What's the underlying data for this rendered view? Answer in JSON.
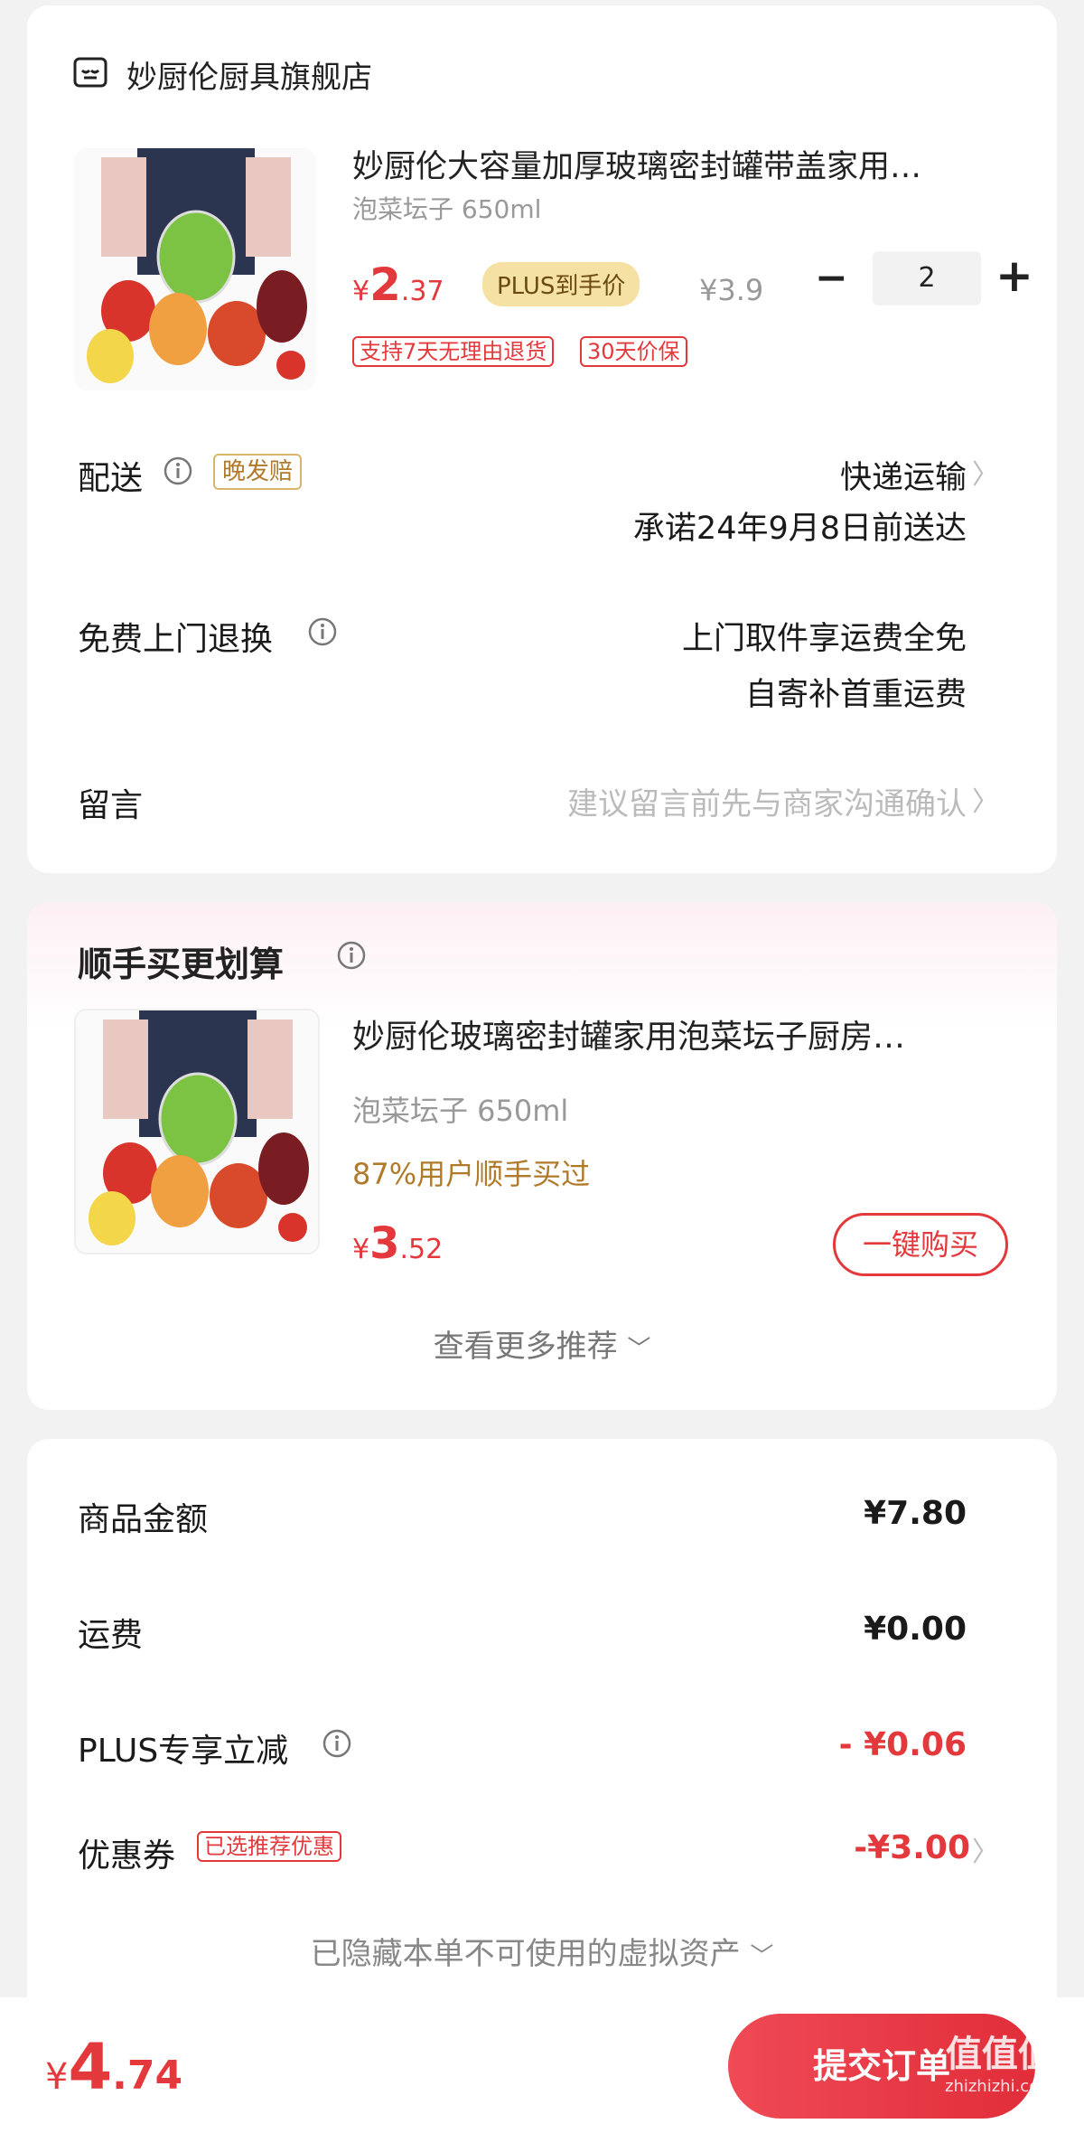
{
  "store": {
    "name": "妙厨伦厨具旗舰店",
    "icon": "store-icon"
  },
  "product": {
    "title": "妙厨伦大容量加厚玻璃密封罐带盖家用…",
    "spec": "泡菜坛子 650ml",
    "price_symbol": "¥",
    "price_int": "2",
    "price_dec": ".37",
    "plus_badge": "PLUS到手价",
    "original_price": "¥3.9",
    "quantity": "2",
    "minus_label": "−",
    "plus_label": "+",
    "tags": [
      "支持7天无理由退货",
      "30天价保"
    ]
  },
  "delivery": {
    "label": "配送",
    "badge": "晚发赔",
    "method": "快递运输",
    "promise": "承诺24年9月8日前送达"
  },
  "return_service": {
    "label": "免费上门退换",
    "line1": "上门取件享运费全免",
    "line2": "自寄补首重运费"
  },
  "message": {
    "label": "留言",
    "placeholder": "建议留言前先与商家沟通确认"
  },
  "recommend": {
    "title": "顺手买更划算",
    "item_title": "妙厨伦玻璃密封罐家用泡菜坛子厨房…",
    "item_spec": "泡菜坛子 650ml",
    "item_note": "87%用户顺手买过",
    "price_symbol": "¥",
    "price_int": "3",
    "price_dec": ".52",
    "buy_button": "一键购买",
    "more": "查看更多推荐"
  },
  "summary": {
    "rows": [
      {
        "label": "商品金额",
        "value": "¥7.80"
      },
      {
        "label": "运费",
        "value": "¥0.00"
      },
      {
        "label": "PLUS专享立减",
        "value": "- ¥0.06"
      },
      {
        "label": "优惠券",
        "value": "-¥3.00",
        "badge": "已选推荐优惠"
      }
    ],
    "hidden_assets": "已隐藏本单不可使用的虚拟资产"
  },
  "footer": {
    "price_symbol": "¥",
    "price_int": "4",
    "price_dec": ".74",
    "submit": "提交订单",
    "watermark": "值值值",
    "watermark_sub": "zhizhizhi.com"
  },
  "colors": {
    "accent": "#e4393c",
    "plus_gold": "#f5e1a4",
    "note_brown": "#b07a2a"
  }
}
